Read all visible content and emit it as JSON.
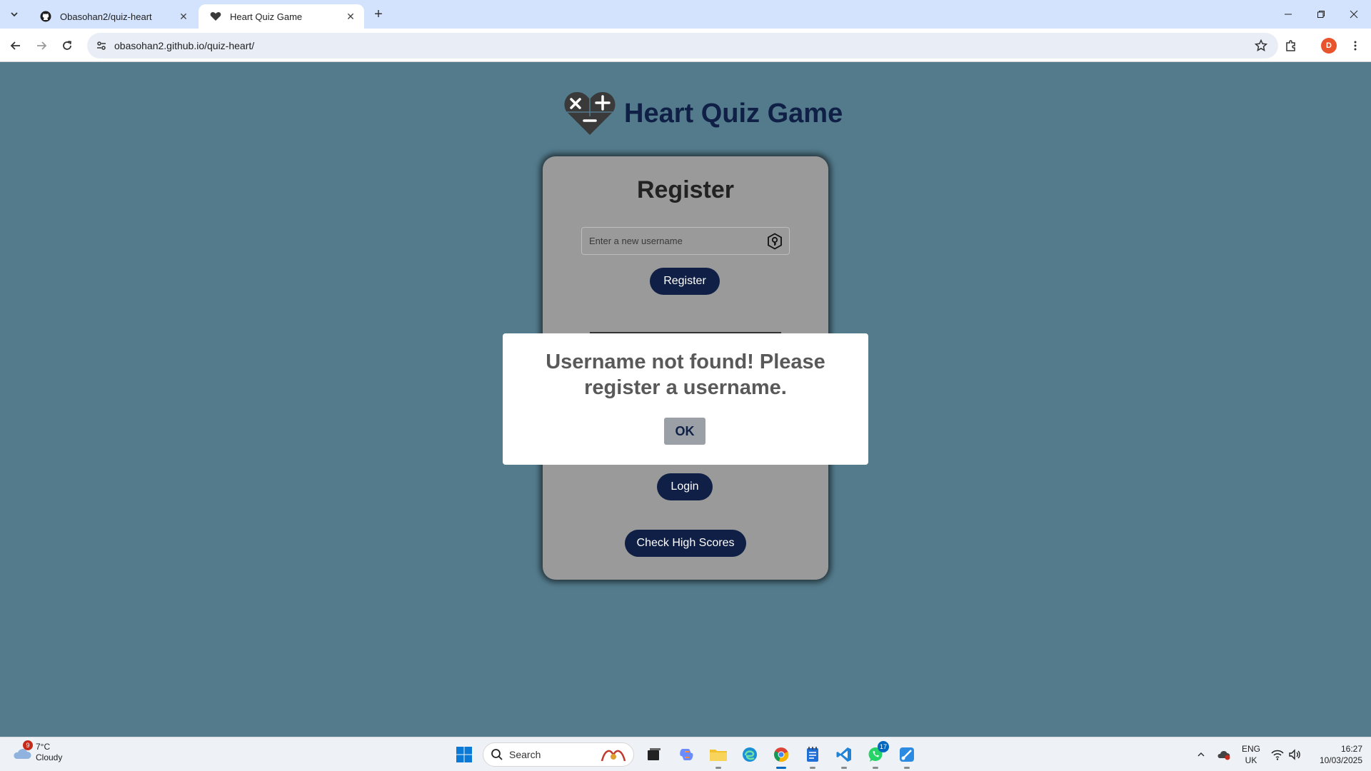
{
  "browser": {
    "tabs": [
      {
        "title": "Obasohan2/quiz-heart",
        "favicon": "github-icon",
        "active": false
      },
      {
        "title": "Heart Quiz Game",
        "favicon": "heart-icon",
        "active": true
      }
    ],
    "url": "obasohan2.github.io/quiz-heart/",
    "profile_initial": "D",
    "profile_color": "#e8542b"
  },
  "page": {
    "brand_title": "Heart Quiz Game",
    "card": {
      "heading": "Register",
      "username_placeholder": "Enter a new username",
      "register_button": "Register",
      "login_button": "Login",
      "highscores_button": "Check High Scores"
    },
    "dialog": {
      "message": "Username not found! Please register a username.",
      "ok_button": "OK"
    },
    "colors": {
      "background": "#537b8c",
      "card": "#9a9a9a",
      "primary": "#0f1f45"
    }
  },
  "taskbar": {
    "weather": {
      "temp": "7°C",
      "condition": "Cloudy",
      "badge": "9"
    },
    "search_label": "Search",
    "whatsapp_badge": "17",
    "language": {
      "line1": "ENG",
      "line2": "UK"
    },
    "time": "16:27",
    "date": "10/03/2025"
  }
}
